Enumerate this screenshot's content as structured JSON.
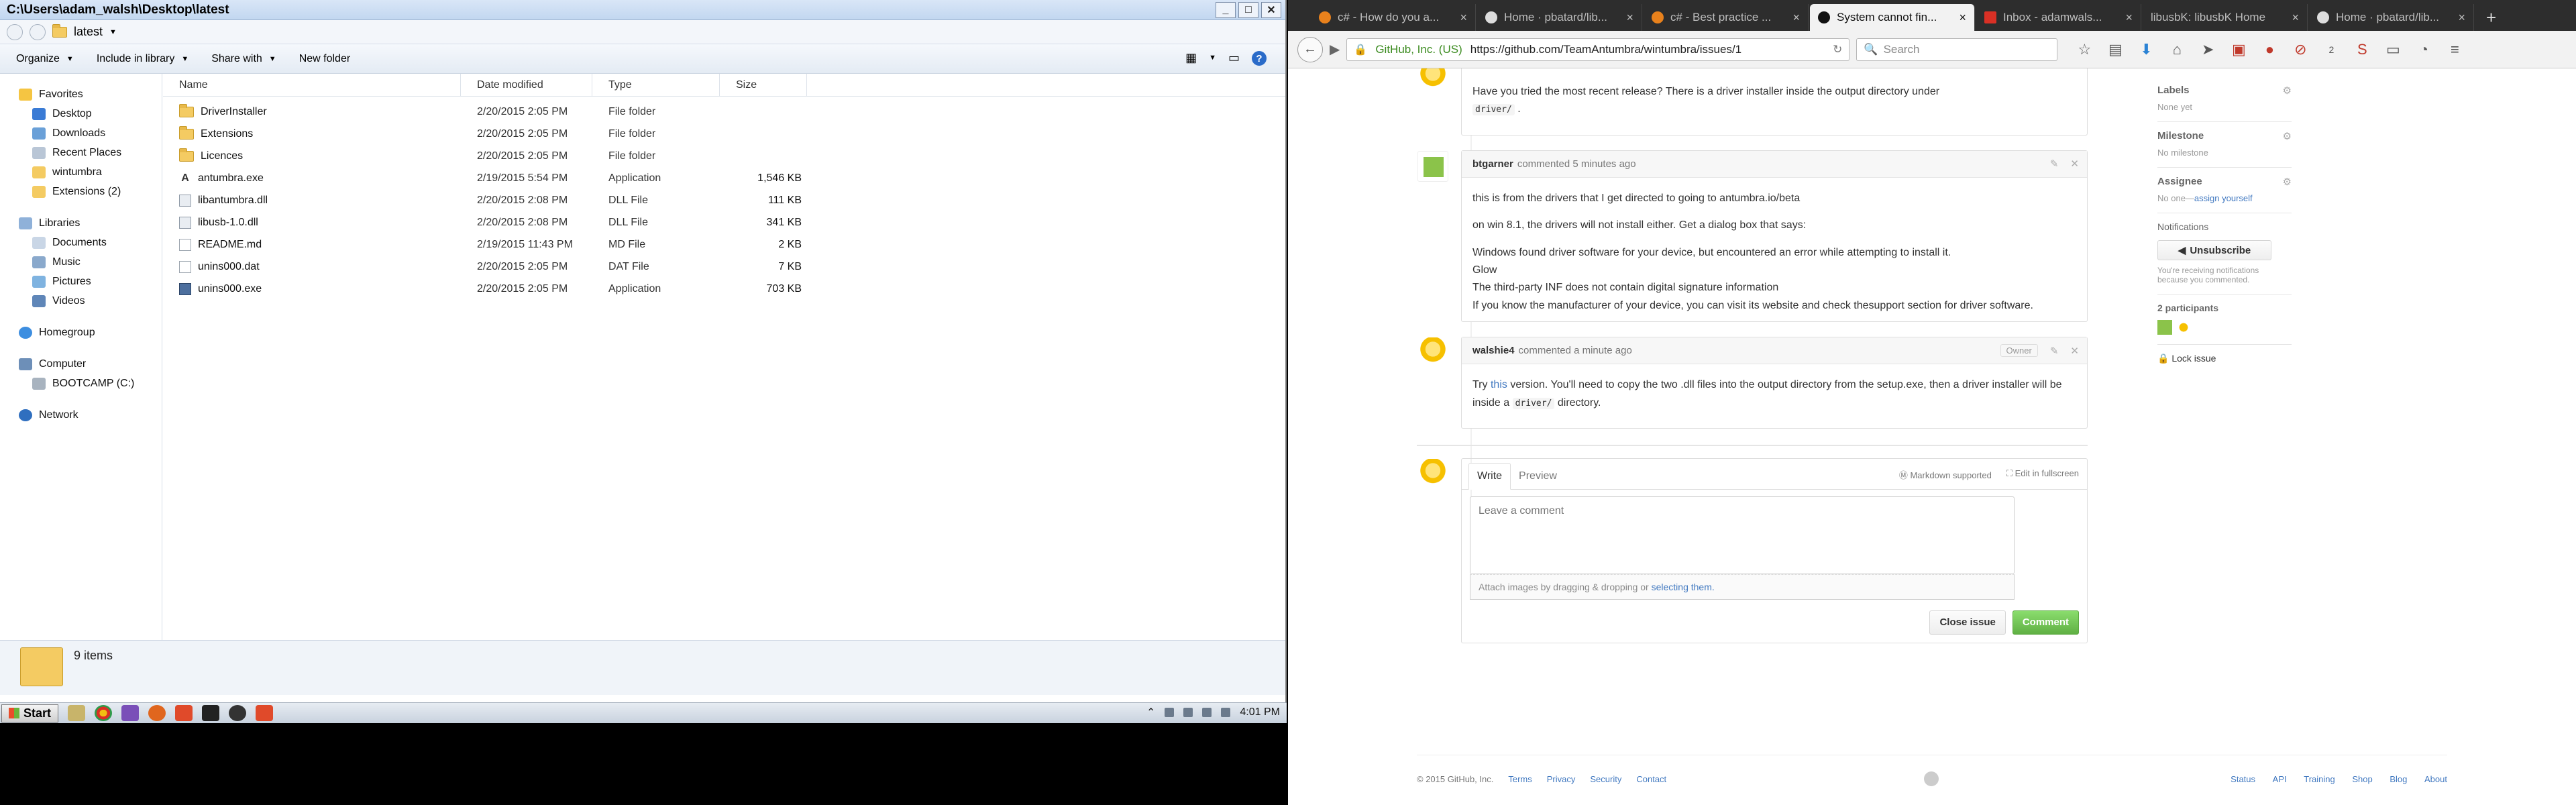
{
  "explorer": {
    "title": "C:\\Users\\adam_walsh\\Desktop\\latest",
    "address": "latest",
    "toolbar": {
      "organize": "Organize",
      "include": "Include in library",
      "share": "Share with",
      "new_folder": "New folder"
    },
    "nav": {
      "favorites": "Favorites",
      "fav_items": [
        "Desktop",
        "Downloads",
        "Recent Places",
        "wintumbra",
        "Extensions (2)"
      ],
      "libraries": "Libraries",
      "lib_items": [
        "Documents",
        "Music",
        "Pictures",
        "Videos"
      ],
      "homegroup": "Homegroup",
      "computer": "Computer",
      "comp_items": [
        "BOOTCAMP (C:)"
      ],
      "network": "Network"
    },
    "columns": {
      "name": "Name",
      "date": "Date modified",
      "type": "Type",
      "size": "Size"
    },
    "files": [
      {
        "name": "DriverInstaller",
        "date": "2/20/2015 2:05 PM",
        "type": "File folder",
        "size": "",
        "icon": "folder-icon"
      },
      {
        "name": "Extensions",
        "date": "2/20/2015 2:05 PM",
        "type": "File folder",
        "size": "",
        "icon": "folder-icon"
      },
      {
        "name": "Licences",
        "date": "2/20/2015 2:05 PM",
        "type": "File folder",
        "size": "",
        "icon": "folder-icon"
      },
      {
        "name": "antumbra.exe",
        "date": "2/19/2015 5:54 PM",
        "type": "Application",
        "size": "1,546 KB",
        "icon": "app-a-icon"
      },
      {
        "name": "libantumbra.dll",
        "date": "2/20/2015 2:08 PM",
        "type": "DLL File",
        "size": "111 KB",
        "icon": "dll-icon"
      },
      {
        "name": "libusb-1.0.dll",
        "date": "2/20/2015 2:08 PM",
        "type": "DLL File",
        "size": "341 KB",
        "icon": "dll-icon"
      },
      {
        "name": "README.md",
        "date": "2/19/2015 11:43 PM",
        "type": "MD File",
        "size": "2 KB",
        "icon": "doc-icon"
      },
      {
        "name": "unins000.dat",
        "date": "2/20/2015 2:05 PM",
        "type": "DAT File",
        "size": "7 KB",
        "icon": "doc-icon"
      },
      {
        "name": "unins000.exe",
        "date": "2/20/2015 2:05 PM",
        "type": "Application",
        "size": "703 KB",
        "icon": "app-icon"
      }
    ],
    "status": "9 items"
  },
  "taskbar": {
    "start": "Start",
    "clock": "4:01 PM"
  },
  "browser": {
    "tabs": [
      {
        "label": "c# - How do you a...",
        "color": "#e8811c"
      },
      {
        "label": "Home · pbatard/lib...",
        "color": "#dddddd"
      },
      {
        "label": "c# - Best practice ...",
        "color": "#e8811c"
      },
      {
        "label": "System cannot fin...",
        "color": "#111111",
        "active": true
      },
      {
        "label": "Inbox - adamwals...",
        "color": "#d93025"
      },
      {
        "label": "libusbK: libusbK Home",
        "color": "#888888"
      },
      {
        "label": "Home · pbatard/lib...",
        "color": "#dddddd"
      }
    ],
    "url_org": "GitHub, Inc. (US)",
    "url": "https://github.com/TeamAntumbra/wintumbra/issues/1",
    "search_placeholder": "Search",
    "badge": "2"
  },
  "github": {
    "comment1_body_prefix": "Have you tried the most recent release? There is a driver installer inside the output directory under",
    "comment1_code": "driver/",
    "comment2": {
      "author": "btgarner",
      "time": "commented 5 minutes ago",
      "paras": [
        "this is from the drivers that I get directed to going to antumbra.io/beta",
        "on win 8.1, the drivers will not install either. Get a dialog box that says:"
      ],
      "quote": [
        "Windows found driver software for your device, but encountered an error while attempting to install it.",
        "Glow",
        "The third-party INF does not contain digital signature information",
        "If you know the manufacturer of your device, you can visit its website and check thesupport section for driver software."
      ]
    },
    "comment3": {
      "author": "walshie4",
      "time": "commented a minute ago",
      "badge": "Owner",
      "try": "Try",
      "this": "this",
      "body_a": "version. You'll need to copy the two .dll files into the output directory from the setup.exe, then a driver installer will be inside a",
      "code": "driver/",
      "body_b": "directory."
    },
    "form": {
      "write": "Write",
      "preview": "Preview",
      "markdown": "Markdown supported",
      "fullscreen": "Edit in fullscreen",
      "placeholder": "Leave a comment",
      "attach": "Attach images by dragging & dropping or",
      "select": "selecting them.",
      "close": "Close issue",
      "comment": "Comment"
    },
    "sidebar": {
      "labels": "Labels",
      "labels_v": "None yet",
      "milestone": "Milestone",
      "milestone_v": "No milestone",
      "assignee": "Assignee",
      "assignee_v": "No one—",
      "assign_self": "assign yourself",
      "notifications": "Notifications",
      "unsubscribe": "Unsubscribe",
      "notif_note": "You're receiving notifications because you commented.",
      "participants": "2 participants",
      "lock": "Lock issue"
    },
    "footer": {
      "copy": "© 2015 GitHub, Inc.",
      "left": [
        "Terms",
        "Privacy",
        "Security",
        "Contact"
      ],
      "right": [
        "Status",
        "API",
        "Training",
        "Shop",
        "Blog",
        "About"
      ]
    }
  }
}
